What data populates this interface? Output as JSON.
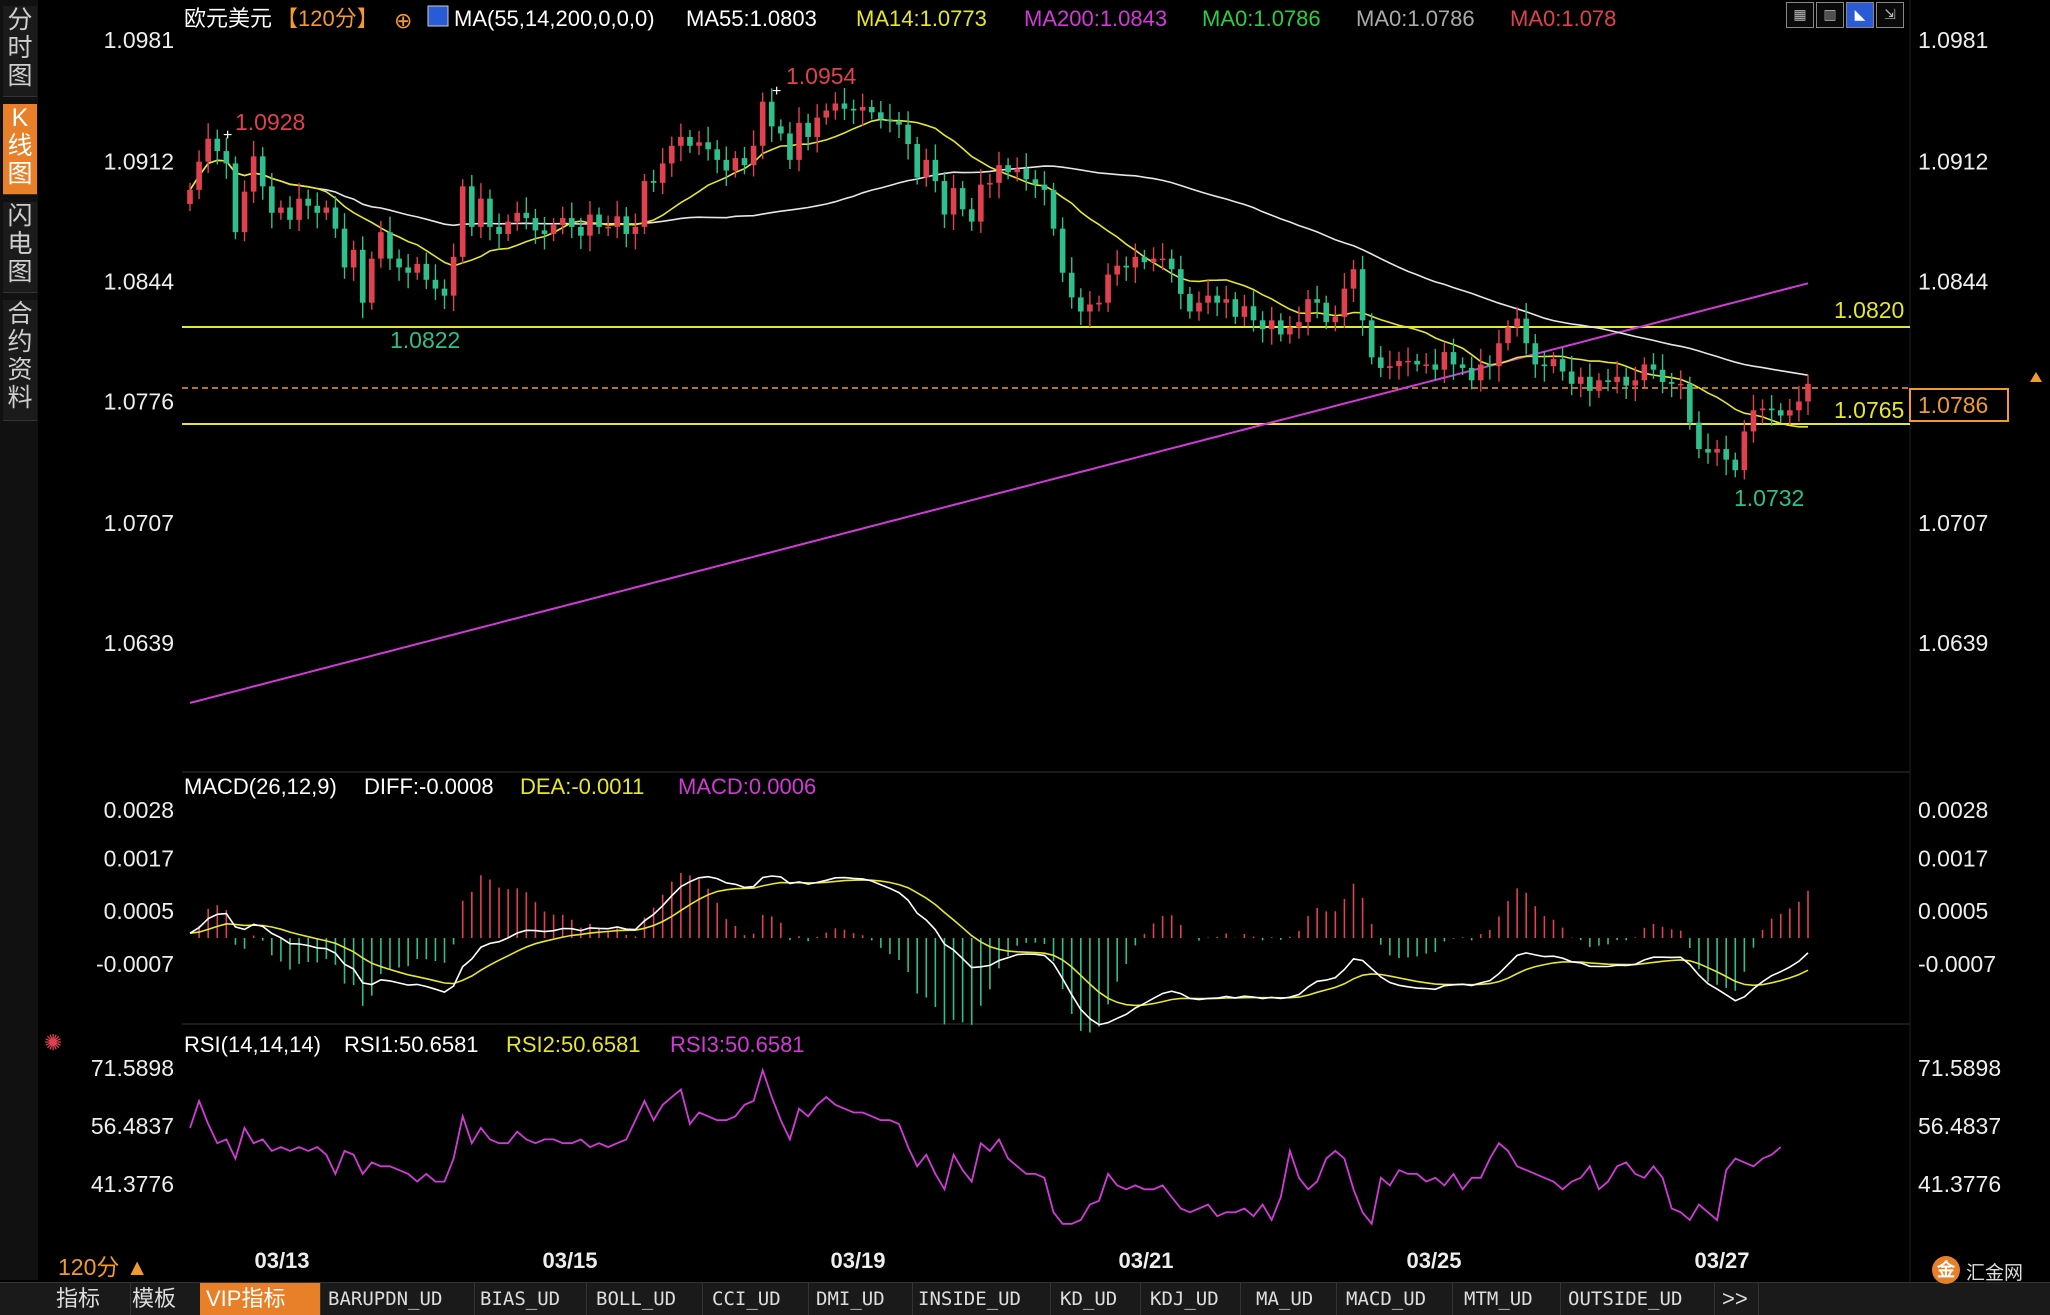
{
  "header": {
    "instrument": "欧元美元",
    "timeframe": "【120分】",
    "ma_label": "MA(55,14,200,0,0,0)",
    "ma55": "MA55:1.0803",
    "ma14": "MA14:1.0773",
    "ma200": "MA200:1.0843",
    "ma0_a": "MA0:1.0786",
    "ma0_b": "MA0:1.0786",
    "ma0_c": "MA0:1.078"
  },
  "sidebar": {
    "items": [
      {
        "label": "分时图"
      },
      {
        "label": "K线图"
      },
      {
        "label": "闪电图"
      },
      {
        "label": "合约资料"
      }
    ]
  },
  "price_axis": {
    "ticks": [
      {
        "value": 1.0981,
        "label": "1.0981"
      },
      {
        "value": 1.0912,
        "label": "1.0912"
      },
      {
        "value": 1.0844,
        "label": "1.0844"
      },
      {
        "value": 1.0776,
        "label": "1.0776"
      },
      {
        "value": 1.0707,
        "label": "1.0707"
      },
      {
        "value": 1.0639,
        "label": "1.0639"
      }
    ]
  },
  "annotations": {
    "high1": "1.0928",
    "high2": "1.0954",
    "low1": "1.0822",
    "low2": "1.0732",
    "hline1": "1.0820",
    "hline2": "1.0765",
    "current_price": "1.0786"
  },
  "x_axis": {
    "labels": [
      "03/13",
      "03/15",
      "03/19",
      "03/21",
      "03/25",
      "03/27"
    ]
  },
  "macd_panel": {
    "label": "MACD(26,12,9)",
    "diff": "DIFF:-0.0008",
    "dea": "DEA:-0.0011",
    "macd": "MACD:0.0006",
    "ticks": [
      {
        "value": 0.0028,
        "label": "0.0028"
      },
      {
        "value": 0.0017,
        "label": "0.0017"
      },
      {
        "value": 0.0005,
        "label": "0.0005"
      },
      {
        "value": -0.0007,
        "label": "-0.0007"
      }
    ]
  },
  "rsi_panel": {
    "label": "RSI(14,14,14)",
    "rsi1": "RSI1:50.6581",
    "rsi2": "RSI2:50.6581",
    "rsi3": "RSI3:50.6581",
    "ticks": [
      {
        "value": 71.5898,
        "label": "71.5898"
      },
      {
        "value": 56.4837,
        "label": "56.4837"
      },
      {
        "value": 41.3776,
        "label": "41.3776"
      }
    ]
  },
  "bottom": {
    "timeframe_badge": "120分 ▲",
    "tabs": [
      "指标",
      "模板",
      "VIP指标",
      "BARUPDN_UD",
      "BIAS_UD",
      "BOLL_UD",
      "CCI_UD",
      "DMI_UD",
      "INSIDE_UD",
      "KD_UD",
      "KDJ_UD",
      "MA_UD",
      "MACD_UD",
      "MTM_UD",
      "OUTSIDE_UD",
      ">>"
    ],
    "logo_text": "汇金网",
    "logo_mark": "金"
  },
  "colors": {
    "up": "#e0414f",
    "down": "#2fbf8c",
    "ma55": "#e6e6e6",
    "ma14": "#e6e62a",
    "ma200": "#d23ad8",
    "diff": "#ffffff",
    "dea": "#e6e62a",
    "rsi": "#d23ad8",
    "hline": "#e6e62a",
    "current_price_box": "#f29b2a"
  },
  "chart_data": [
    {
      "type": "candlestick",
      "title": "欧元美元 120分",
      "x_labels": [
        "03/13",
        "03/15",
        "03/19",
        "03/21",
        "03/25",
        "03/27"
      ],
      "ylim": [
        1.0585,
        1.0995
      ],
      "marked_high": [
        1.0928,
        1.0954
      ],
      "marked_low": [
        1.0822,
        1.0732
      ],
      "horizontal_lines": [
        1.082,
        1.0765
      ],
      "current_price": 1.0786,
      "series": [
        {
          "name": "MA55",
          "last": 1.0803
        },
        {
          "name": "MA14",
          "last": 1.0773
        },
        {
          "name": "MA200",
          "last": 1.0843
        }
      ],
      "close": [
        1.0896,
        1.0912,
        1.0925,
        1.0918,
        1.0911,
        1.0872,
        1.0895,
        1.0915,
        1.0898,
        1.0883,
        1.0886,
        1.0879,
        1.0891,
        1.0887,
        1.0883,
        1.0886,
        1.0874,
        1.0852,
        1.0862,
        1.0832,
        1.0857,
        1.0872,
        1.0857,
        1.0852,
        1.0849,
        1.0854,
        1.0845,
        1.084,
        1.0836,
        1.0858,
        1.0898,
        1.0875,
        1.0891,
        1.0875,
        1.0871,
        1.0878,
        1.0883,
        1.088,
        1.0873,
        1.0871,
        1.0876,
        1.088,
        1.0875,
        1.087,
        1.0882,
        1.0875,
        1.0875,
        1.0881,
        1.0871,
        1.0875,
        1.0901,
        1.09,
        1.0911,
        1.0921,
        1.0926,
        1.0921,
        1.0923,
        1.0919,
        1.0913,
        1.0907,
        1.0914,
        1.091,
        1.0921,
        1.0946,
        1.0932,
        1.0928,
        1.0913,
        1.0934,
        1.0926,
        1.0937,
        1.0941,
        1.0945,
        1.0942,
        1.0941,
        1.0943,
        1.094,
        1.0936,
        1.0935,
        1.0933,
        1.0922,
        1.0903,
        1.0913,
        1.0901,
        1.0882,
        1.0897,
        1.0885,
        1.0878,
        1.0899,
        1.09,
        1.091,
        1.0906,
        1.0908,
        1.0902,
        1.0899,
        1.0896,
        1.0874,
        1.0849,
        1.0835,
        1.0827,
        1.0831,
        1.0832,
        1.0848,
        1.0853,
        1.0852,
        1.0858,
        1.0855,
        1.0857,
        1.0857,
        1.0851,
        1.0837,
        1.0827,
        1.0832,
        1.0836,
        1.0832,
        1.0834,
        1.0824,
        1.083,
        1.0822,
        1.0817,
        1.0822,
        1.0814,
        1.0818,
        1.0821,
        1.0834,
        1.0832,
        1.0821,
        1.0824,
        1.084,
        1.0851,
        1.0822,
        1.0801,
        1.0795,
        1.0796,
        1.0799,
        1.0799,
        1.0797,
        1.0797,
        1.0794,
        1.0804,
        1.0797,
        1.0795,
        1.0788,
        1.0797,
        1.0796,
        1.0809,
        1.0818,
        1.0823,
        1.0809,
        1.0797,
        1.0796,
        1.08,
        1.0793,
        1.0786,
        1.079,
        1.0782,
        1.0788,
        1.0787,
        1.079,
        1.0785,
        1.0788,
        1.0797,
        1.0794,
        1.0787,
        1.0786,
        1.0786,
        1.0764,
        1.0749,
        1.0747,
        1.0749,
        1.0743,
        1.0737,
        1.0759,
        1.0771,
        1.0772,
        1.0771,
        1.0768,
        1.0771,
        1.0776,
        1.0786
      ]
    },
    {
      "type": "line",
      "title": "MACD(26,12,9)",
      "ylim": [
        -0.0016,
        0.0032
      ],
      "series": [
        {
          "name": "DIFF",
          "last": -0.0008
        },
        {
          "name": "DEA",
          "last": -0.0011
        },
        {
          "name": "MACD",
          "last": 0.0006
        }
      ]
    },
    {
      "type": "line",
      "title": "RSI(14,14,14)",
      "ylim": [
        30.0,
        75.0
      ],
      "series": [
        {
          "name": "RSI1",
          "last": 50.6581
        },
        {
          "name": "RSI2",
          "last": 50.6581
        },
        {
          "name": "RSI3",
          "last": 50.6581
        }
      ],
      "values": [
        56,
        63,
        57,
        52,
        53,
        48,
        56,
        52,
        53,
        50,
        51,
        50,
        51,
        50,
        51,
        49,
        44,
        50,
        49,
        44,
        47,
        46,
        46,
        45,
        44,
        42,
        44,
        42,
        42,
        48,
        59,
        52,
        56,
        53,
        52,
        52,
        55,
        53,
        52,
        53,
        53,
        52,
        52,
        53,
        51,
        52,
        51,
        52,
        53,
        58,
        63,
        58,
        62,
        64,
        66,
        57,
        60,
        59,
        58,
        58,
        59,
        62,
        63,
        71,
        64,
        58,
        53,
        61,
        59,
        62,
        64,
        62,
        61,
        60,
        60,
        59,
        58,
        58,
        57,
        51,
        46,
        49,
        44,
        40,
        49,
        45,
        42,
        52,
        50,
        53,
        48,
        46,
        44,
        44,
        43,
        34,
        31,
        31,
        32,
        36,
        37,
        44,
        41,
        40,
        41,
        40,
        40,
        41,
        38,
        35,
        34,
        35,
        36,
        33,
        34,
        34,
        35,
        33,
        36,
        32,
        38,
        50,
        43,
        40,
        42,
        48,
        50,
        48,
        40,
        34,
        31,
        43,
        41,
        45,
        44,
        44,
        42,
        43,
        41,
        44,
        40,
        43,
        43,
        48,
        52,
        50,
        46,
        45,
        44,
        43,
        42,
        40,
        42,
        43,
        46,
        40,
        42,
        46,
        47,
        44,
        43,
        46,
        43,
        35,
        34,
        32,
        36,
        34,
        32,
        45,
        48,
        47,
        46,
        48,
        49,
        51
      ]
    }
  ]
}
